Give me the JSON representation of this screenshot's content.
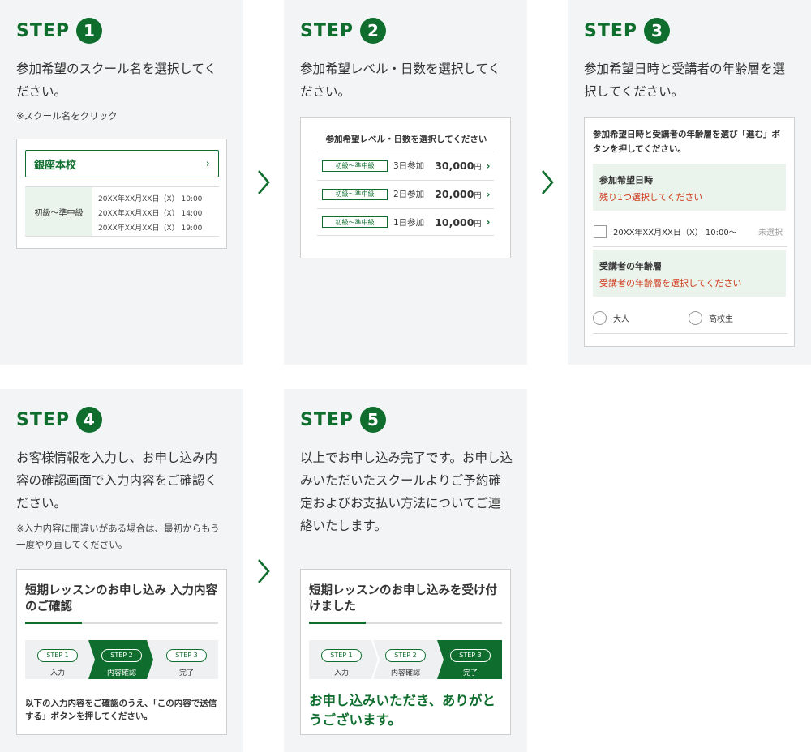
{
  "step_word": "STEP",
  "steps": [
    {
      "num": "1",
      "desc": "参加希望のスクール名を選択してください。",
      "note": "※スクール名をクリック",
      "school": "銀座本校",
      "level": "初級〜準中級",
      "dates": [
        "20XX年XX月XX日（X） 10:00",
        "20XX年XX月XX日（X） 14:00",
        "20XX年XX月XX日（X） 19:00"
      ]
    },
    {
      "num": "2",
      "desc": "参加希望レベル・日数を選択してください。",
      "card_title": "参加希望レベル・日数を選択してください",
      "plans": [
        {
          "level": "初級〜準中級",
          "days": "3日参加",
          "price": "30,000",
          "unit": "円"
        },
        {
          "level": "初級〜準中級",
          "days": "2日参加",
          "price": "20,000",
          "unit": "円"
        },
        {
          "level": "初級〜準中級",
          "days": "1日参加",
          "price": "10,000",
          "unit": "円"
        }
      ]
    },
    {
      "num": "3",
      "desc": "参加希望日時と受講者の年齢層を選択してください。",
      "card_title": "参加希望日時と受講者の年齢層を選び「進む」ボタンを押してください。",
      "date_section": {
        "heading": "参加希望日時",
        "required": "残り1つ選択してください"
      },
      "date_option": {
        "text": "20XX年XX月XX日（X） 10:00〜",
        "status": "未選択"
      },
      "age_section": {
        "heading": "受講者の年齢層",
        "required": "受講者の年齢層を選択してください"
      },
      "age_options": [
        "大人",
        "高校生"
      ]
    },
    {
      "num": "4",
      "desc": "お客様情報を入力し、お申し込み内容の確認画面で入力内容をご確認ください。",
      "note": "※入力内容に間違いがある場合は、最初からもう一度やり直してください。",
      "card_title": "短期レッスンのお申し込み 入力内容のご確認",
      "flow": [
        {
          "pill": "STEP 1",
          "label": "入力"
        },
        {
          "pill": "STEP 2",
          "label": "内容確認"
        },
        {
          "pill": "STEP 3",
          "label": "完了"
        }
      ],
      "footer": "以下の入力内容をご確認のうえ、「この内容で送信する」ボタンを押してください。"
    },
    {
      "num": "5",
      "desc": "以上でお申し込み完了です。お申し込みいただいたスクールよりご予約確定およびお支払い方法についてご連絡いたします。",
      "card_title": "短期レッスンのお申し込みを受け付けました",
      "flow": [
        {
          "pill": "STEP 1",
          "label": "入力"
        },
        {
          "pill": "STEP 2",
          "label": "内容確認"
        },
        {
          "pill": "STEP 3",
          "label": "完了"
        }
      ],
      "footer": "お申し込みいただき、ありがとうございます。"
    }
  ],
  "colors": {
    "accent": "#0f6e2e",
    "panel": "#f3f4f6",
    "light_green": "#eaf3ec",
    "alert": "#d03a1a"
  }
}
